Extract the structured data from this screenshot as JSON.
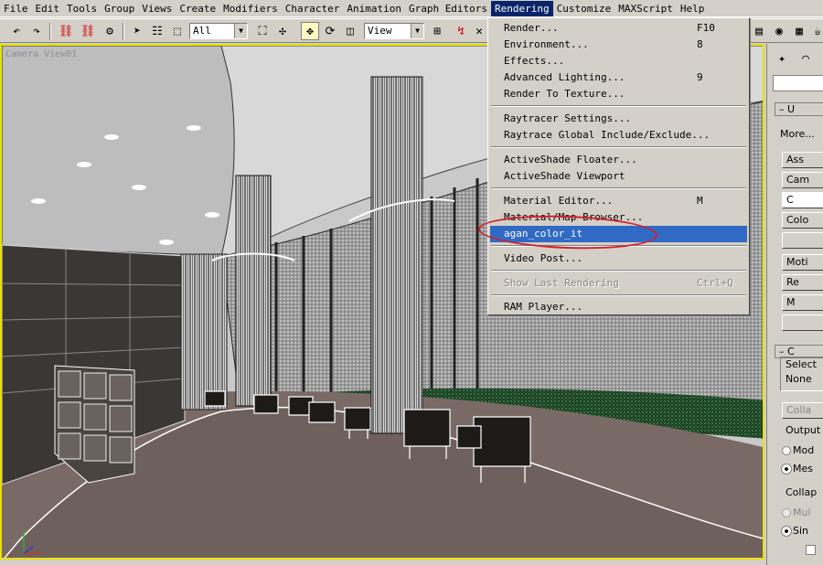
{
  "menubar": {
    "items": [
      "File",
      "Edit",
      "Tools",
      "Group",
      "Views",
      "Create",
      "Modifiers",
      "Character",
      "Animation",
      "Graph Editors",
      "Rendering",
      "Customize",
      "MAXScript",
      "Help"
    ],
    "active": "Rendering"
  },
  "toolbar": {
    "selection_filter": "All",
    "reference_coord": "View"
  },
  "viewport": {
    "label": "Camera View01"
  },
  "rendering_menu": {
    "items": [
      {
        "label": "Render...",
        "shortcut": "F10"
      },
      {
        "label": "Environment...",
        "shortcut": "8"
      },
      {
        "label": "Effects...",
        "shortcut": ""
      },
      {
        "label": "Advanced Lighting...",
        "shortcut": "9"
      },
      {
        "label": "Render To Texture...",
        "shortcut": ""
      },
      {
        "label": "Raytracer Settings...",
        "shortcut": ""
      },
      {
        "label": "Raytrace Global Include/Exclude...",
        "shortcut": ""
      },
      {
        "label": "ActiveShade Floater...",
        "shortcut": ""
      },
      {
        "label": "ActiveShade Viewport",
        "shortcut": ""
      },
      {
        "label": "Material Editor...",
        "shortcut": "M"
      },
      {
        "label": "Material/Map Browser...",
        "shortcut": ""
      },
      {
        "label": "agan_color_it",
        "shortcut": "",
        "highlighted": true
      },
      {
        "label": "Video Post...",
        "shortcut": ""
      },
      {
        "label": "Show Last Rendering",
        "shortcut": "Ctrl+Q",
        "disabled": true
      },
      {
        "label": "RAM Player...",
        "shortcut": ""
      }
    ]
  },
  "command_panel": {
    "more": "More...",
    "buttons": [
      "Ass",
      "Cam",
      "C",
      "Colo",
      "",
      "Moti",
      "Re",
      "M",
      ""
    ],
    "selection_label": "Select",
    "selection_value": "None",
    "collapse_btn": "Colla",
    "output_label": "Output",
    "output_opts": [
      "Mod",
      "Mes"
    ],
    "collapse_label": "Collap",
    "collapse_opts": [
      "Mul",
      "Sin"
    ]
  },
  "colors": {
    "menu_highlight": "#316ac5",
    "viewport_border": "#e8e000",
    "annotation": "#d2202a"
  }
}
